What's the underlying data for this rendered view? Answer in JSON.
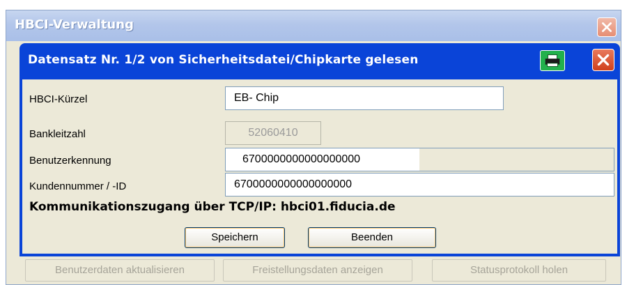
{
  "outer_window": {
    "title": "HBCI-Verwaltung"
  },
  "dialog": {
    "title": "Datensatz Nr. 1/2 von Sicherheitsdatei/Chipkarte gelesen",
    "fields": {
      "kuerzel": {
        "label": "HBCI-Kürzel",
        "value": "EB- Chip"
      },
      "blz": {
        "label": "Bankleitzahl",
        "value": "52060410"
      },
      "benutzer": {
        "label": "Benutzerkennung",
        "value": "6700000000000000000"
      },
      "kunde": {
        "label": "Kundennummer / -ID",
        "value": "6700000000000000000"
      }
    },
    "communication": "Kommunikationszugang über TCP/IP: hbci01.fiducia.de",
    "buttons": {
      "save": "Speichern",
      "close": "Beenden"
    }
  },
  "bottom_buttons": {
    "update_user": "Benutzerdaten aktualisieren",
    "show_exemptions": "Freistellungsdaten anzeigen",
    "fetch_log": "Statusprotokoll holen"
  },
  "icons": {
    "print": "printer-icon",
    "close": "close-icon"
  },
  "colors": {
    "dialog_title_bg": "#0a44d8",
    "print_button_bg": "#22b14c",
    "close_button_bg": "#d0401c"
  }
}
